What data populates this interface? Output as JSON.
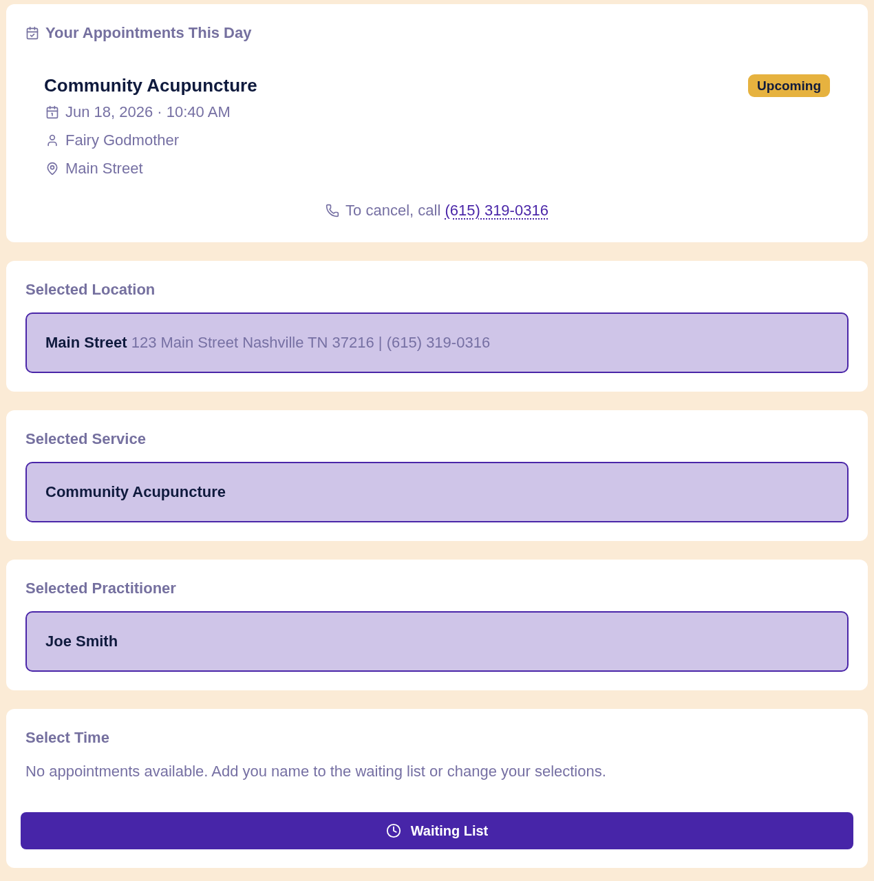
{
  "appointments_card": {
    "title": "Your Appointments This Day",
    "appointments": [
      {
        "service": "Community Acupuncture",
        "status": {
          "kind": "upcoming",
          "label": "Upcoming"
        },
        "details": [
          {
            "kind": "date",
            "text": "Jun 18, 2026 · 10:40 AM"
          },
          {
            "kind": "person",
            "text": "Fairy Godmother"
          },
          {
            "kind": "location",
            "text": "Main Street"
          }
        ]
      }
    ],
    "cancel_note": {
      "text": "To cancel, call",
      "phone": "(615) 319-0316"
    }
  },
  "selections": [
    {
      "title": "Selected Location",
      "name": "Main Street",
      "detail": "123 Main Street Nashville TN 37216 | (615) 319-0316",
      "selected": true
    },
    {
      "title": "Selected Service",
      "name": "Community Acupuncture",
      "selected": true
    },
    {
      "title": "Selected Practitioner",
      "name": "Joe Smith",
      "selected": true
    }
  ],
  "time": {
    "title": "Select Time",
    "message": "No appointments available. Add you name to the waiting list or change your selections.",
    "button": "Waiting List"
  }
}
